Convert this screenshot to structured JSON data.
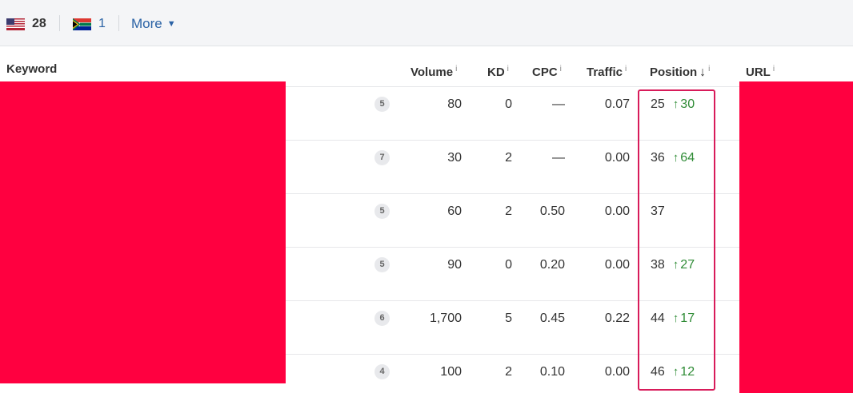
{
  "filters": {
    "countries": [
      {
        "flag": "us-flag-icon",
        "count": "28"
      },
      {
        "flag": "za-flag-icon",
        "count": "1"
      }
    ],
    "more_label": "More",
    "more_caret": "▼"
  },
  "table": {
    "headers": {
      "keyword": "Keyword",
      "volume": "Volume",
      "kd": "KD",
      "cpc": "CPC",
      "traffic": "Traffic",
      "position": "Position",
      "url": "URL",
      "info_glyph": "i",
      "sort_glyph": "↓"
    },
    "rows": [
      {
        "sf": "5",
        "volume": "80",
        "kd": "0",
        "cpc": "—",
        "traffic": "0.07",
        "position": "25",
        "change": "30"
      },
      {
        "sf": "7",
        "volume": "30",
        "kd": "2",
        "cpc": "—",
        "traffic": "0.00",
        "position": "36",
        "change": "64"
      },
      {
        "sf": "5",
        "volume": "60",
        "kd": "2",
        "cpc": "0.50",
        "traffic": "0.00",
        "position": "37",
        "change": ""
      },
      {
        "sf": "5",
        "volume": "90",
        "kd": "0",
        "cpc": "0.20",
        "traffic": "0.00",
        "position": "38",
        "change": "27"
      },
      {
        "sf": "6",
        "volume": "1,700",
        "kd": "5",
        "cpc": "0.45",
        "traffic": "0.22",
        "position": "44",
        "change": "17"
      },
      {
        "sf": "4",
        "volume": "100",
        "kd": "2",
        "cpc": "0.10",
        "traffic": "0.00",
        "position": "46",
        "change": "12"
      }
    ],
    "up_glyph": "↑"
  },
  "colors": {
    "redaction": "#ff0040",
    "highlight": "#d81b5a",
    "link": "#2a62a5",
    "positive": "#2e8b35"
  }
}
